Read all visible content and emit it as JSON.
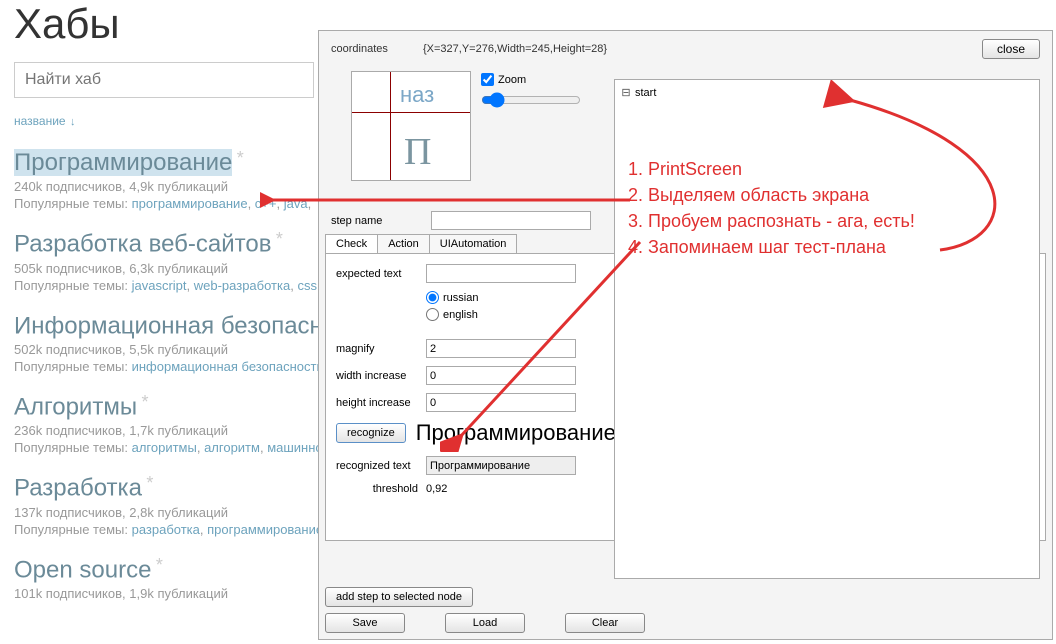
{
  "page": {
    "title": "Хабы"
  },
  "search": {
    "placeholder": "Найти хаб"
  },
  "sort": {
    "label": "название",
    "arrow": "↓"
  },
  "hubs": [
    {
      "name": "Программирование",
      "meta": "240k подписчиков, 4,9k публикаций",
      "topics_prefix": "Популярные темы: ",
      "topics": [
        "программирование",
        "с++",
        "java"
      ],
      "selected": true
    },
    {
      "name": "Разработка веб-сайтов",
      "meta": "505k подписчиков, 6,3k публикаций",
      "topics_prefix": "Популярные темы: ",
      "topics": [
        "javascript",
        "web-разработка",
        "css"
      ]
    },
    {
      "name": "Информационная безопасность",
      "meta": "502k подписчиков, 5,5k публикаций",
      "topics_prefix": "Популярные темы: ",
      "topics": [
        "информационная безопасность"
      ]
    },
    {
      "name": "Алгоритмы",
      "meta": "236k подписчиков, 1,7k публикаций",
      "topics_prefix": "Популярные темы: ",
      "topics": [
        "алгоритмы",
        "алгоритм",
        "машинно"
      ]
    },
    {
      "name": "Разработка",
      "meta": "137k подписчиков, 2,8k публикаций",
      "topics_prefix": "Популярные темы: ",
      "topics": [
        "разработка",
        "программирование"
      ]
    },
    {
      "name": "Open source",
      "meta": "101k подписчиков, 1,9k публикаций",
      "topics_prefix": "Популярные темы: ",
      "topics": []
    }
  ],
  "tool": {
    "coord_label": "coordinates",
    "coord_value": "{X=327,Y=276,Width=245,Height=28}",
    "close": "close",
    "zoom_label": "Zoom",
    "zoom_checked": true,
    "preview_text1": "наз",
    "preview_text2": "П",
    "step_name_label": "step name",
    "step_name_value": "",
    "tabs": [
      "Check",
      "Action",
      "UIAutomation"
    ],
    "active_tab": 0,
    "check": {
      "expected_label": "expected text",
      "expected_value": "",
      "lang_russian": "russian",
      "lang_english": "english",
      "lang_selected": "russian",
      "magnify_label": "magnify",
      "magnify_value": "2",
      "width_label": "width increase",
      "width_value": "0",
      "height_label": "height increase",
      "height_value": "0",
      "recognize_btn": "recognize",
      "recognize_result_big": "Программирование",
      "recognized_label": "recognized text",
      "recognized_value": "Программирование",
      "threshold_label": "threshold",
      "threshold_value": "0,92"
    },
    "add_step_btn": "add step to selected node",
    "save_btn": "Save",
    "load_btn": "Load",
    "clear_btn": "Clear",
    "tree_root": "start"
  },
  "annotations": {
    "steps": [
      "1. PrintScreen",
      "2. Выделяем область  экрана",
      "3. Пробуем распознать - ага, есть!",
      "4. Запоминаем шаг тест-плана"
    ]
  }
}
